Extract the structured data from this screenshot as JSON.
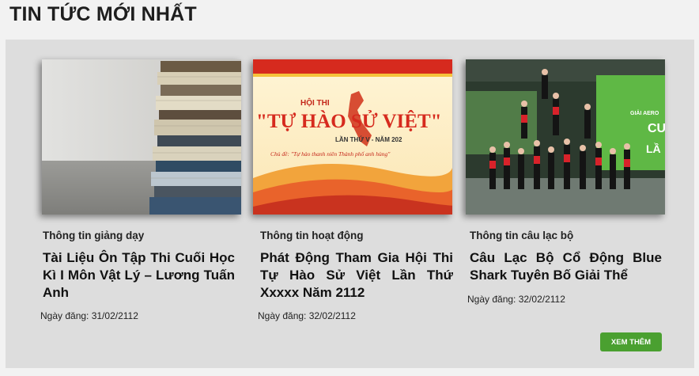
{
  "section": {
    "title": "TIN TỨC MỚI NHẤT"
  },
  "news": [
    {
      "category": "Thông tin giảng dạy",
      "title": "Tài Liệu Ôn Tập Thi Cuối Học Kì I Môn Vật Lý – Lương Tuấn Anh",
      "date": "Ngày đăng: 31/02/2112"
    },
    {
      "category": "Thông tin hoạt động",
      "title": "Phát Động Tham Gia Hội Thi Tự Hào Sử Việt Lần Thứ Xxxxx Năm 2112",
      "date": "Ngày đăng: 32/02/2112",
      "image_text": {
        "line1": "HỘI THI",
        "line2": "\"TỰ HÀO SỬ VIỆT\"",
        "line3": "LẦN THỨ V - NĂM 202",
        "line4": "Chủ đề: \"Tự hào thanh niên Thành phố anh hùng\""
      }
    },
    {
      "category": "Thông tin câu lạc bộ",
      "title": "Câu Lạc Bộ Cổ Động Blue Shark Tuyên Bố Giải Thể",
      "date": "Ngày đăng: 32/02/2112",
      "image_text": {
        "line1": "GIẢI AERO",
        "line2": "CU",
        "line3": "LẦ"
      }
    }
  ],
  "more_button": {
    "label": "XEM THÊM"
  },
  "colors": {
    "button": "#4aa030",
    "panel": "#dddddd",
    "title_text": "#1e1e1e"
  }
}
